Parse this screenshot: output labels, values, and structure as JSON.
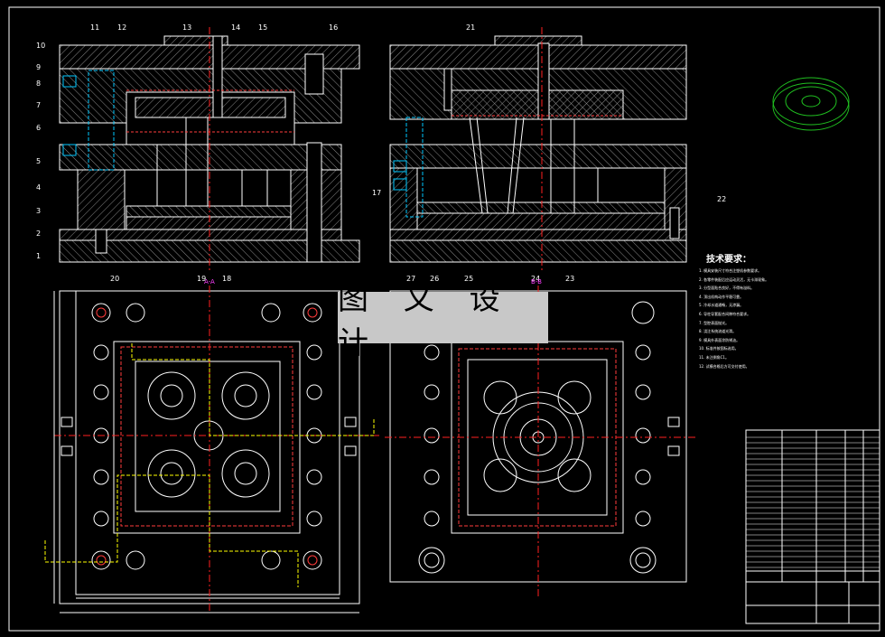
{
  "overlay": {
    "text": "图 文 设 计"
  },
  "tech_requirements": {
    "title": "技术要求：",
    "notes": [
      "1. 模具安装尺寸符合注塑机参数要求。",
      "2. 各零件装配后应运动灵活，无卡滞现象。",
      "3. 分型面贴合良好，不得有溢料。",
      "4. 顶出机构动作平稳可靠。",
      "5. 冷却水道通畅，无渗漏。",
      "6. 导柱导套配合间隙符合要求。",
      "7. 型腔表面抛光。",
      "8. 浇注系统流道光滑。",
      "9. 模具外表面涂防锈油。",
      "10. 标准件按国标选用。",
      "11. 未注倒角C1。",
      "12. 试模合格后方可交付使用。"
    ]
  },
  "part_labels": [
    "1",
    "2",
    "3",
    "4",
    "5",
    "6",
    "7",
    "8",
    "9",
    "10",
    "11",
    "12",
    "13",
    "14",
    "15",
    "16",
    "17",
    "18",
    "19",
    "20",
    "21",
    "22",
    "23",
    "24",
    "25",
    "26",
    "27"
  ],
  "section_labels": {
    "a": "A-A",
    "b": "B-B"
  },
  "colors": {
    "background": "#000000",
    "line": "#ffffff",
    "hatch": "#9a9a9a",
    "centerline": "#ff2020",
    "cavity": "#ff3b3b",
    "dimension": "#ffff00",
    "thread": "#00c8ff",
    "leader": "#ff40ff",
    "part_view": "#20c020"
  }
}
